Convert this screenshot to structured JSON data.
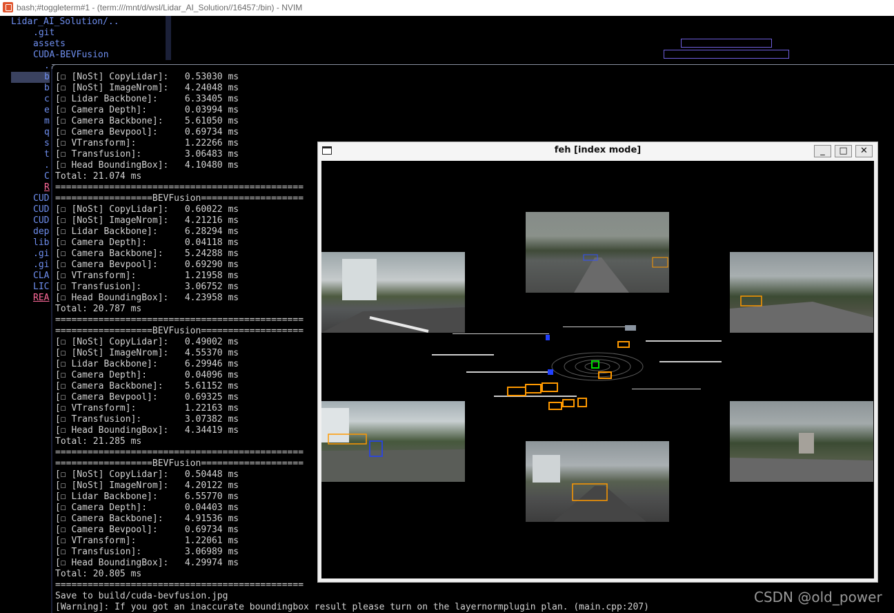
{
  "window": {
    "title": "bash;#toggleterm#1 - (term:///mnt/d/wsl/Lidar_AI_Solution//16457:/bin) - NVIM",
    "icon": "terminal-app-icon"
  },
  "file_tree": {
    "root": "Lidar_AI_Solution/..",
    "top_items": [
      ".git",
      "assets",
      "CUDA-BEVFusion"
    ],
    "nested_chars": [
      ".",
      "b",
      "b",
      "c",
      "e",
      "m",
      "q",
      "s",
      "t",
      ".",
      "C",
      "R"
    ],
    "lower_items": [
      "CUD",
      "CUD",
      "CUD",
      "dep",
      "lib",
      ".gi",
      ".gi",
      "CLA",
      "LIC",
      "REA"
    ]
  },
  "terminal": {
    "runs": [
      {
        "header": "",
        "rows": [
          {
            "label": "[NoSt] CopyLidar]:",
            "value": "0.53030 ms"
          },
          {
            "label": "[NoSt] ImageNrom]:",
            "value": "4.24048 ms"
          },
          {
            "label": "Lidar Backbone]:",
            "value": "6.33405 ms"
          },
          {
            "label": "Camera Depth]:",
            "value": "0.03994 ms"
          },
          {
            "label": "Camera Backbone]:",
            "value": "5.61050 ms"
          },
          {
            "label": "Camera Bevpool]:",
            "value": "0.69734 ms"
          },
          {
            "label": "VTransform]:",
            "value": "1.22266 ms"
          },
          {
            "label": "Transfusion]:",
            "value": "3.06483 ms"
          },
          {
            "label": "Head BoundingBox]:",
            "value": "4.10480 ms"
          }
        ],
        "total": "Total: 21.074 ms"
      },
      {
        "header": "==================BEVFusion===================",
        "rows": [
          {
            "label": "[NoSt] CopyLidar]:",
            "value": "0.60022 ms"
          },
          {
            "label": "[NoSt] ImageNrom]:",
            "value": "4.21216 ms"
          },
          {
            "label": "Lidar Backbone]:",
            "value": "6.28294 ms"
          },
          {
            "label": "Camera Depth]:",
            "value": "0.04118 ms"
          },
          {
            "label": "Camera Backbone]:",
            "value": "5.24288 ms"
          },
          {
            "label": "Camera Bevpool]:",
            "value": "0.69290 ms"
          },
          {
            "label": "VTransform]:",
            "value": "1.21958 ms"
          },
          {
            "label": "Transfusion]:",
            "value": "3.06752 ms"
          },
          {
            "label": "Head BoundingBox]:",
            "value": "4.23958 ms"
          }
        ],
        "total": "Total: 20.787 ms"
      },
      {
        "header": "==================BEVFusion===================",
        "rows": [
          {
            "label": "[NoSt] CopyLidar]:",
            "value": "0.49002 ms"
          },
          {
            "label": "[NoSt] ImageNrom]:",
            "value": "4.55370 ms"
          },
          {
            "label": "Lidar Backbone]:",
            "value": "6.29946 ms"
          },
          {
            "label": "Camera Depth]:",
            "value": "0.04096 ms"
          },
          {
            "label": "Camera Backbone]:",
            "value": "5.61152 ms"
          },
          {
            "label": "Camera Bevpool]:",
            "value": "0.69325 ms"
          },
          {
            "label": "VTransform]:",
            "value": "1.22163 ms"
          },
          {
            "label": "Transfusion]:",
            "value": "3.07382 ms"
          },
          {
            "label": "Head BoundingBox]:",
            "value": "4.34419 ms"
          }
        ],
        "total": "Total: 21.285 ms"
      },
      {
        "header": "==================BEVFusion===================",
        "rows": [
          {
            "label": "[NoSt] CopyLidar]:",
            "value": "0.50448 ms"
          },
          {
            "label": "[NoSt] ImageNrom]:",
            "value": "4.20122 ms"
          },
          {
            "label": "Lidar Backbone]:",
            "value": "6.55770 ms"
          },
          {
            "label": "Camera Depth]:",
            "value": "0.04403 ms"
          },
          {
            "label": "Camera Backbone]:",
            "value": "4.91536 ms"
          },
          {
            "label": "Camera Bevpool]:",
            "value": "0.69734 ms"
          },
          {
            "label": "VTransform]:",
            "value": "1.22061 ms"
          },
          {
            "label": "Transfusion]:",
            "value": "3.06989 ms"
          },
          {
            "label": "Head BoundingBox]:",
            "value": "4.29974 ms"
          }
        ],
        "total": "Total: 20.805 ms"
      }
    ],
    "separator": "==============================================",
    "save_line": "Save to build/cuda-bevfusion.jpg",
    "warning_line": "[Warning]: If you got an inaccurate boundingbox result please turn on the layernormplugin plan. (main.cpp:207)"
  },
  "feh": {
    "title": "feh [index mode]",
    "minimize": "_",
    "maximize": "□",
    "close": "✕"
  },
  "colors": {
    "tree_blue": "#6f8ff0",
    "box_orange": "#ff9900",
    "box_green": "#00dd00",
    "box_blue": "#2040ff"
  },
  "watermark": "CSDN @old_power"
}
